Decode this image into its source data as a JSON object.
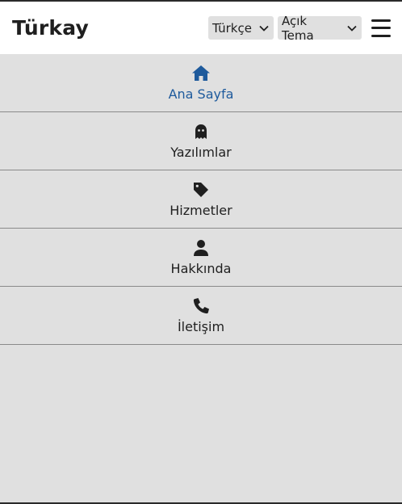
{
  "header": {
    "brand": "Türkay",
    "language_select": "Türkçe",
    "theme_select": "Açık Tema"
  },
  "colors": {
    "active": "#1e5a9c",
    "text": "#1f1f1f",
    "menu_background": "#e0e0e0"
  },
  "nav": {
    "items": [
      {
        "label": "Ana Sayfa",
        "icon": "home-icon",
        "active": true
      },
      {
        "label": "Yazılımlar",
        "icon": "ghost-icon",
        "active": false
      },
      {
        "label": "Hizmetler",
        "icon": "tag-icon",
        "active": false
      },
      {
        "label": "Hakkında",
        "icon": "user-icon",
        "active": false
      },
      {
        "label": "İletişim",
        "icon": "phone-icon",
        "active": false
      }
    ]
  }
}
